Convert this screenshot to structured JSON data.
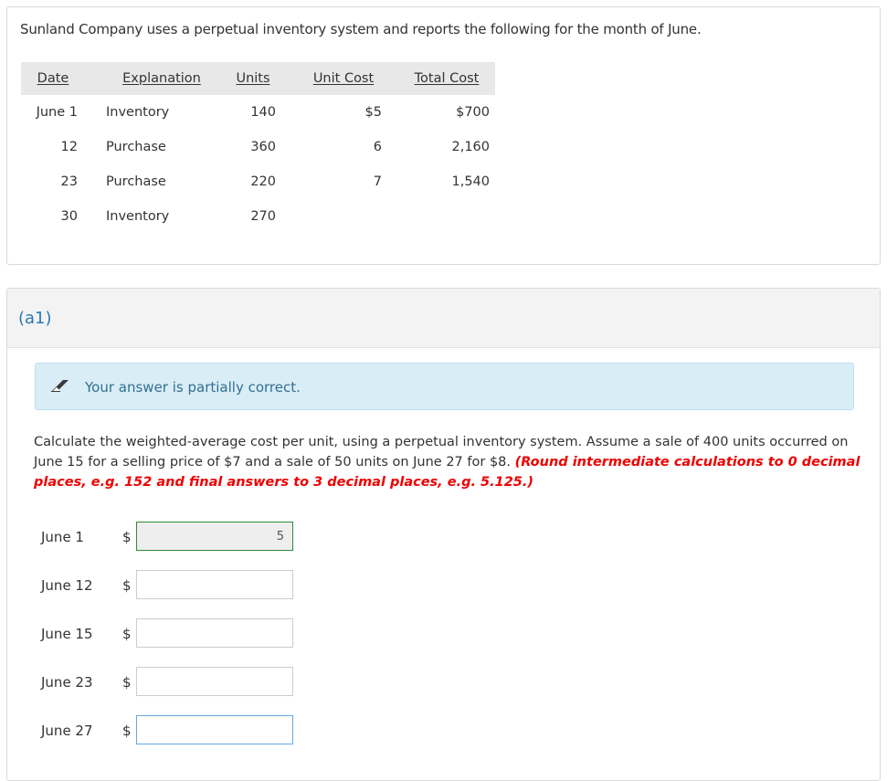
{
  "intro": "Sunland Company uses a perpetual inventory system and reports the following for the month of June.",
  "table": {
    "headers": [
      "Date",
      "Explanation",
      "Units",
      "Unit Cost",
      "Total Cost"
    ],
    "rows": [
      {
        "date": "June 1",
        "explanation": "Inventory",
        "units": "140",
        "unit_cost": "$5",
        "total_cost": "$700"
      },
      {
        "date": "12",
        "explanation": "Purchase",
        "units": "360",
        "unit_cost": "6",
        "total_cost": "2,160"
      },
      {
        "date": "23",
        "explanation": "Purchase",
        "units": "220",
        "unit_cost": "7",
        "total_cost": "1,540"
      },
      {
        "date": "30",
        "explanation": "Inventory",
        "units": "270",
        "unit_cost": "",
        "total_cost": ""
      }
    ]
  },
  "part_label": "(a1)",
  "alert": {
    "text": "Your answer is partially correct.",
    "icon": "pencil-icon"
  },
  "question": {
    "text": "Calculate the weighted-average cost per unit, using a perpetual inventory system. Assume a sale of 400 units occurred on June 15 for a selling price of $7 and a sale of 50 units on June 27 for $8.",
    "instruction": "(Round intermediate calculations to 0 decimal places, e.g. 152 and final answers to 3 decimal places, e.g. 5.125.)"
  },
  "answers": [
    {
      "label": "June 1",
      "currency": "$",
      "value": "5"
    },
    {
      "label": "June 12",
      "currency": "$",
      "value": ""
    },
    {
      "label": "June 15",
      "currency": "$",
      "value": ""
    },
    {
      "label": "June 23",
      "currency": "$",
      "value": ""
    },
    {
      "label": "June 27",
      "currency": "$",
      "value": ""
    }
  ],
  "colors": {
    "accent": "#2a78b8",
    "alert_bg": "#d9edf7",
    "correct_border": "#2f8b3c",
    "instruction_red": "#ee0000"
  }
}
